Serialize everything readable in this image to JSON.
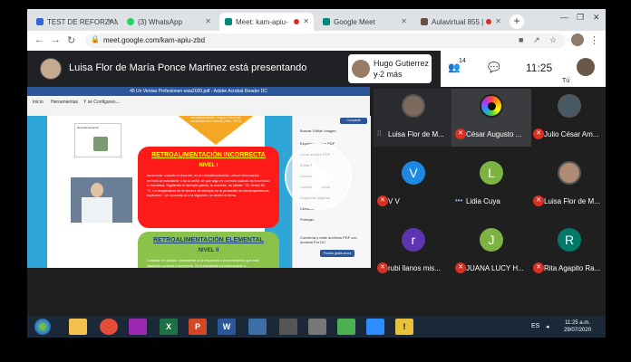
{
  "browser": {
    "tabs": [
      {
        "label": "TEST DE REFORZAMIE",
        "color": "#3367d6",
        "active": false
      },
      {
        "label": "(3) WhatsApp",
        "color": "#25d366",
        "active": false
      },
      {
        "label": "Meet: kam-apiu-",
        "color": "#00897b",
        "active": true
      },
      {
        "label": "Google Meet",
        "color": "#00897b",
        "active": false
      },
      {
        "label": "Aulavirtual 855 |",
        "color": "#6d4c41",
        "active": false
      }
    ],
    "new_tab": "+",
    "url": "meet.google.com/kam-apiu-zbd"
  },
  "meet": {
    "presenting_text": "Luisa Flor de María Ponce Martinez está presentando",
    "presenter_pill": {
      "name": "Hugo Gutierrez ...",
      "more": "y 2 más"
    },
    "participant_count": "14",
    "clock": "11:25",
    "you_label": "Tú",
    "participants": [
      {
        "name": "Luisa Flor de M...",
        "initial": "",
        "color": "",
        "muted": false,
        "active": true,
        "kind": "photo"
      },
      {
        "name": "César Augusto ...",
        "initial": "",
        "color": "",
        "muted": true,
        "active": true,
        "kind": "ring"
      },
      {
        "name": "Julio César Am...",
        "initial": "",
        "color": "",
        "muted": true,
        "active": false,
        "kind": "photo"
      },
      {
        "name": "V V",
        "initial": "V",
        "color": "#1e88e5",
        "muted": true,
        "active": false,
        "kind": "letter"
      },
      {
        "name": "Lidia Cuya",
        "initial": "L",
        "color": "#7cb342",
        "muted": false,
        "active": false,
        "kind": "letter"
      },
      {
        "name": "Luisa Flor de M...",
        "initial": "",
        "color": "",
        "muted": true,
        "active": false,
        "kind": "photo"
      },
      {
        "name": "rubi llanos mis...",
        "initial": "r",
        "color": "#5e35b1",
        "muted": true,
        "active": false,
        "kind": "letter"
      },
      {
        "name": "JUANA LUCY H...",
        "initial": "J",
        "color": "#7cb342",
        "muted": true,
        "active": false,
        "kind": "letter"
      },
      {
        "name": "Rita Agapito Ra...",
        "initial": "R",
        "color": "#00796b",
        "muted": true,
        "active": false,
        "kind": "letter"
      }
    ]
  },
  "shared_doc": {
    "window_title": "45 Un Ventas Profesionen esta2020.pdf - Adobe Acrobat Reader DC",
    "ribbon_items": [
      "Inicio",
      "Herramientas",
      "Y se Configures..."
    ],
    "thumb_caption": "Retroalimentación",
    "arrow_text": "retroalimentación, según el nivel de desarrollo de la misma (Ortiz, 2010)",
    "red_title": "RETROALIMENTACIÓN INCORRECTA",
    "red_level": "NIVEL I",
    "red_body": "Incorrecto: cuando el docente, en el retroalimentación, ofrece información errónea al estudiante o da la señal de que algo es correcto cuando es incorrecto o viceversa. Siguiendo el ejemplo previo, la docente, no pierde. \"Sí, tienes 80 °C. La temperatura de la tercera de siempre es el promedio de las temperaturas tropicales\", se concluirá al a la siguiente no dentro el tema.",
    "green_title": "RETROALIMENTACIÓN ELEMENTAL",
    "green_level": "NIVEL II",
    "green_body": "Consiste en señalar únicamente si la respuesta o procedimiento que está haciendo correcto o incorrecto. Si el estudiante ha reaccionado a...",
    "side_items": [
      "Buscar 'Editar' imagen",
      "Exportar archivo PDF",
      "Crear archivo PDF",
      "Editar PDF",
      "Comentar",
      "Combinar archivos",
      "Organizar páginas",
      "Censurar",
      "Proteger"
    ],
    "side_share": "Compartir",
    "side_footer": "Convierta y edite archivos PDF con Acrobat Pro DC",
    "side_button": "Pruebe gratis ahora"
  },
  "taskbar": {
    "apps": [
      {
        "label": "",
        "color": "#f4c04d"
      },
      {
        "label": "",
        "color": "#e44c3a"
      },
      {
        "label": "",
        "color": "#9c27b0"
      },
      {
        "label": "X",
        "color": "#1e7145"
      },
      {
        "label": "P",
        "color": "#d24726"
      },
      {
        "label": "W",
        "color": "#2b579a"
      },
      {
        "label": "",
        "color": "#3b6ea5"
      },
      {
        "label": "",
        "color": "#555"
      },
      {
        "label": "",
        "color": "#777"
      },
      {
        "label": "",
        "color": "#2d8cff"
      },
      {
        "label": "",
        "color": "#3b6ea5"
      },
      {
        "label": "!",
        "color": "#e8c23a"
      }
    ],
    "language": "ES",
    "time": "11:25 a.m.",
    "date": "29/07/2020"
  }
}
